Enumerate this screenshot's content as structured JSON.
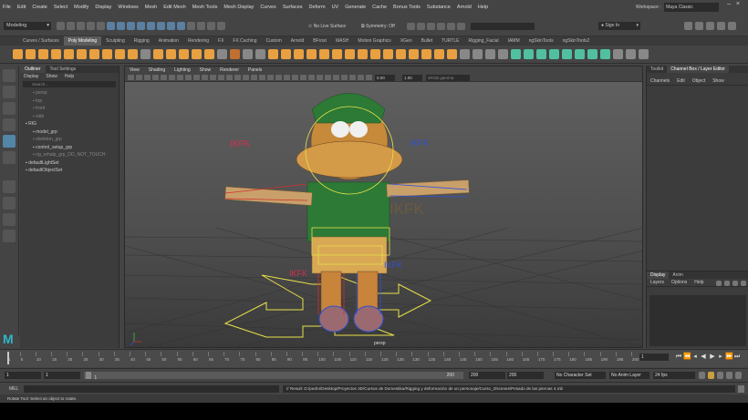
{
  "menubar": {
    "items": [
      "File",
      "Edit",
      "Create",
      "Select",
      "Modify",
      "Display",
      "Windows",
      "Mesh",
      "Edit Mesh",
      "Mesh Tools",
      "Mesh Display",
      "Curves",
      "Surfaces",
      "Deform",
      "UV",
      "Generate",
      "Cache",
      "Bonus Tools",
      "Substance",
      "Arnold",
      "Help"
    ],
    "workspace_label": "Workspace :",
    "workspace_value": "Maya Classic"
  },
  "statusline": {
    "mode": "Modeling",
    "live_surface": "No Live Surface",
    "symmetry": "Symmetry: Off",
    "sign_in": "Sign In"
  },
  "shelf": {
    "tabs": [
      "Curves / Surfaces",
      "Poly Modeling",
      "Sculpting",
      "Rigging",
      "Animation",
      "Rendering",
      "FX",
      "FX Caching",
      "Custom",
      "Arnold",
      "BFrost",
      "MASH",
      "Motion Graphics",
      "XGen",
      "Bullet",
      "TURTLE",
      "Rigging_Facial",
      "IAMM",
      "ngSkinTools",
      "ngSkinTools2"
    ],
    "active_tab": 1,
    "icon_colors": [
      "#e8a040",
      "#e8a040",
      "#e8a040",
      "#e8a040",
      "#e8a040",
      "#e8a040",
      "#e8a040",
      "#e8a040",
      "#e8a040",
      "#e8a040",
      "#888888",
      "#e8a040",
      "#e8a040",
      "#e8a040",
      "#e8a040",
      "#e8a040",
      "#888888",
      "#c07030",
      "#888888",
      "#888888",
      "#e8a040",
      "#e8a040",
      "#e8a040",
      "#e8a040",
      "#e8a040",
      "#e8a040",
      "#e8a040",
      "#e8a040",
      "#e8a040",
      "#e8a040",
      "#e8a040",
      "#e8a040",
      "#e8a040",
      "#e8a040",
      "#e8a040",
      "#888888",
      "#888888",
      "#888888",
      "#888888",
      "#50c0a0",
      "#50c0a0",
      "#50c0a0",
      "#50c0a0",
      "#50c0a0",
      "#50c0a0",
      "#50c0a0",
      "#50c0a0",
      "#888888",
      "#888888",
      "#888888"
    ]
  },
  "outliner": {
    "tabs": [
      "Outliner",
      "Tool Settings"
    ],
    "menu": [
      "Display",
      "Show",
      "Help"
    ],
    "search_placeholder": "Search...",
    "items": [
      {
        "label": "persp",
        "dim": true,
        "indent": 14
      },
      {
        "label": "top",
        "dim": true,
        "indent": 14
      },
      {
        "label": "front",
        "dim": true,
        "indent": 14
      },
      {
        "label": "side",
        "dim": true,
        "indent": 14
      },
      {
        "label": "RIG",
        "dim": false,
        "indent": 6
      },
      {
        "label": "model_grp",
        "dim": false,
        "indent": 14
      },
      {
        "label": "skeleton_grp",
        "dim": true,
        "indent": 14
      },
      {
        "label": "control_setup_grp",
        "dim": false,
        "indent": 14
      },
      {
        "label": "rig_rehalp_grp_DO_NOT_TOUCH",
        "dim": true,
        "indent": 14
      },
      {
        "label": "defaultLightSet",
        "dim": false,
        "indent": 6
      },
      {
        "label": "defaultObjectSet",
        "dim": false,
        "indent": 6
      }
    ]
  },
  "viewport": {
    "menu": [
      "View",
      "Shading",
      "Lighting",
      "Show",
      "Renderer",
      "Panels"
    ],
    "field1": "0.00",
    "field2": "1.00",
    "colorspace": "sRGB gamma",
    "camera_label": "persp",
    "ikfk_labels": [
      "IKFK",
      "IKFK",
      "IKFK",
      "IKFK",
      "IKFK"
    ]
  },
  "rightpanel": {
    "tabs": [
      "Toolkit",
      "Channel Box / Layer Editor"
    ],
    "menu": [
      "Channels",
      "Edit",
      "Object",
      "Show"
    ],
    "layer_tabs": [
      "Display",
      "Anim"
    ],
    "layer_menu": [
      "Layers",
      "Options",
      "Help"
    ]
  },
  "timeline": {
    "tick_labels": [
      "1",
      "5",
      "10",
      "15",
      "20",
      "25",
      "30",
      "35",
      "40",
      "45",
      "50",
      "55",
      "60",
      "65",
      "70",
      "75",
      "80",
      "85",
      "90",
      "95",
      "100",
      "105",
      "110",
      "115",
      "120",
      "125",
      "130",
      "135",
      "140",
      "145",
      "150",
      "155",
      "160",
      "165",
      "170",
      "175",
      "180",
      "185",
      "190",
      "195",
      "200"
    ],
    "current_frame": "1"
  },
  "range": {
    "start": "1",
    "inner_start": "1",
    "slider_value": "1",
    "inner_end": "200",
    "end": "200",
    "end2": "200",
    "character_set": "No Character Set",
    "anim_layer": "No Anim Layer",
    "fps": "24 fps"
  },
  "cmdline": {
    "lang": "MEL",
    "result": "// Result: D:/pedro/Desktop/Proyectos 3D/Cursos de Domestika/Rigging y deformación de un personaje/Curso_2/scenes/Pesado de las piernas 4.mb"
  },
  "helpline": {
    "text": "Rotate Tool: Select an object to rotate."
  }
}
